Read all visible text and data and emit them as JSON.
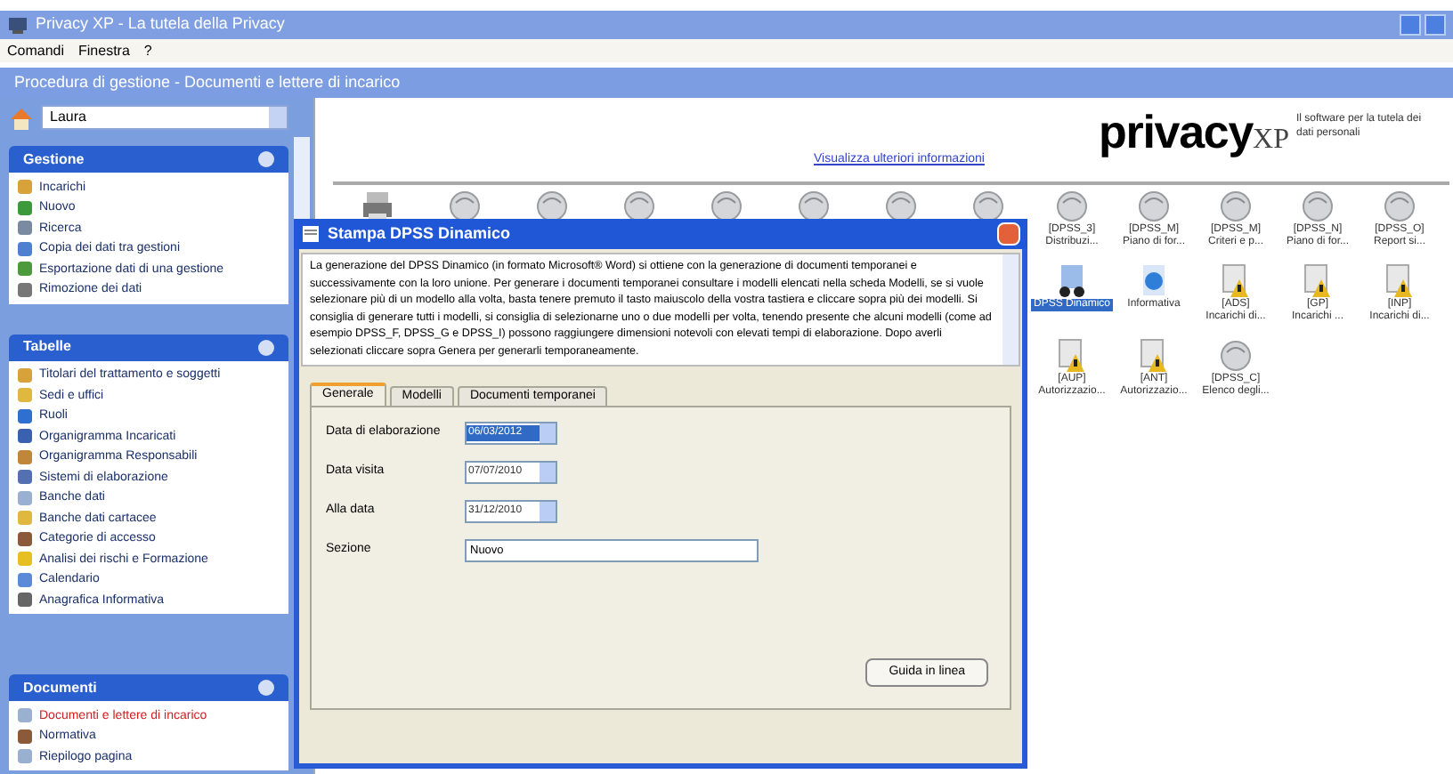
{
  "window": {
    "title": "Privacy XP - La tutela della Privacy"
  },
  "menu": [
    "Comandi",
    "Finestra",
    "?"
  ],
  "inner_window": {
    "title": "Procedura di gestione - Documenti e lettere di incarico"
  },
  "sidebar": {
    "selector": "Laura",
    "groups": [
      {
        "title": "Gestione",
        "items": [
          {
            "label": "Incarichi",
            "selected": false
          },
          {
            "label": "Nuovo",
            "selected": false
          },
          {
            "label": "Ricerca",
            "selected": false
          },
          {
            "label": "Copia dei dati tra gestioni",
            "selected": false
          },
          {
            "label": "Esportazione dati di una gestione",
            "selected": false
          },
          {
            "label": "Rimozione dei dati",
            "selected": false
          }
        ]
      },
      {
        "title": "Tabelle",
        "items": [
          {
            "label": "Titolari del trattamento e soggetti",
            "selected": false
          },
          {
            "label": "Sedi e uffici",
            "selected": false
          },
          {
            "label": "Ruoli",
            "selected": false
          },
          {
            "label": "Organigramma Incaricati",
            "selected": false
          },
          {
            "label": "Organigramma Responsabili",
            "selected": false
          },
          {
            "label": "Sistemi di elaborazione",
            "selected": false
          },
          {
            "label": "Banche dati",
            "selected": false
          },
          {
            "label": "Banche dati cartacee",
            "selected": false
          },
          {
            "label": "Categorie di accesso",
            "selected": false
          },
          {
            "label": "Analisi dei rischi e Formazione",
            "selected": false
          },
          {
            "label": "Calendario",
            "selected": false
          },
          {
            "label": "Anagrafica Informativa",
            "selected": false
          }
        ]
      },
      {
        "title": "Documenti",
        "items": [
          {
            "label": "Documenti e lettere di incarico",
            "selected": true
          },
          {
            "label": "Normativa",
            "selected": false
          },
          {
            "label": "Riepilogo pagina",
            "selected": false
          }
        ]
      }
    ]
  },
  "header": {
    "logo": "privacy",
    "logo_suffix": "XP",
    "tagline": "Il software per la tutela dei dati personali",
    "link": "Visualizza ulteriori informazioni"
  },
  "documents": [
    {
      "kind": "printer"
    },
    {
      "kind": "globe"
    },
    {
      "kind": "globe"
    },
    {
      "kind": "globe"
    },
    {
      "kind": "globe"
    },
    {
      "kind": "globe"
    },
    {
      "kind": "globe"
    },
    {
      "kind": "globe"
    },
    {
      "kind": "globe",
      "code": "[DPSS_3]",
      "label": "Distribuzi..."
    },
    {
      "kind": "globe",
      "code": "[DPSS_M]",
      "label": "Piano di for..."
    },
    {
      "kind": "globe",
      "code": "[DPSS_M]",
      "label": "Criteri e p..."
    },
    {
      "kind": "globe",
      "code": "[DPSS_N]",
      "label": "Piano di for..."
    },
    {
      "kind": "globe",
      "code": "[DPSS_O]",
      "label": "Report si..."
    },
    {
      "kind": "dpss",
      "label": "DPSS Dinamico",
      "selected": true
    },
    {
      "kind": "info",
      "label": "Informativa",
      "selected": false
    },
    {
      "kind": "lockdoc",
      "code": "[ADS]",
      "label": "Incarichi di..."
    },
    {
      "kind": "lockdoc",
      "code": "[GP]",
      "label": "Incarichi ..."
    },
    {
      "kind": "lockdoc",
      "code": "[INP]",
      "label": "Incarichi di..."
    },
    {
      "kind": "lockdoc",
      "code": "[AUP]",
      "label": "Autorizzazio..."
    },
    {
      "kind": "lockdoc",
      "code": "[ANT]",
      "label": "Autorizzazio..."
    },
    {
      "kind": "globe",
      "code": "[DPSS_C]",
      "label": "Elenco degli..."
    }
  ],
  "dialog": {
    "title": "Stampa DPSS Dinamico",
    "description": "La generazione del DPSS Dinamico (in formato Microsoft® Word) si ottiene con la generazione di documenti temporanei e successivamente con la loro unione. Per generare i documenti temporanei consultare i modelli elencati nella scheda Modelli, se si vuole selezionare più di un modello alla volta, basta tenere premuto il tasto maiuscolo della vostra tastiera e cliccare sopra più dei modelli. Si consiglia di generare tutti i modelli, si consiglia di selezionarne uno o due modelli per volta, tenendo presente che alcuni modelli (come ad esempio DPSS_F, DPSS_G e DPSS_I) possono raggiungere dimensioni notevoli con elevati tempi di elaborazione. Dopo averli selezionati cliccare sopra Genera per generarli temporaneamente.",
    "tabs": [
      {
        "label": "Generale",
        "selected": true
      },
      {
        "label": "Modelli",
        "selected": false
      },
      {
        "label": "Documenti temporanei",
        "selected": false
      }
    ],
    "fields": [
      {
        "kind": "date",
        "label": "Data di elaborazione",
        "value": "06/03/2012",
        "focused": true
      },
      {
        "kind": "date",
        "label": "Data visita",
        "value": "07/07/2010",
        "focused": false
      },
      {
        "kind": "date",
        "label": "Alla data",
        "value": "31/12/2010",
        "focused": false
      },
      {
        "kind": "text",
        "label": "Sezione",
        "value": "Nuovo"
      }
    ],
    "button": "Guida in linea"
  }
}
